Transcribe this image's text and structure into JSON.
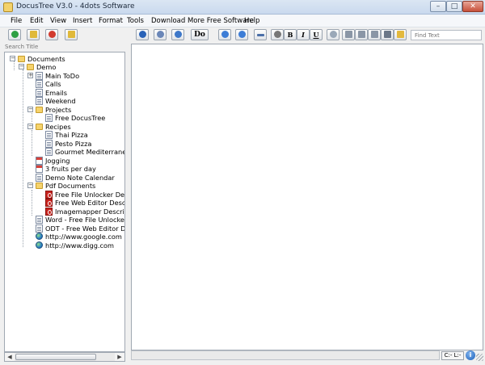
{
  "window": {
    "title": "DocusTree V3.0 - 4dots Software",
    "min": "–",
    "max": "□",
    "close": "✕"
  },
  "menu": [
    "File",
    "Edit",
    "View",
    "Insert",
    "Format",
    "Tools",
    "Download More Free Software",
    "Help"
  ],
  "toolbar": {
    "left": [
      {
        "name": "add-node-button",
        "icon": "green-plus-icon",
        "color": "#2ea043"
      },
      {
        "name": "add-folder-button",
        "icon": "folder-add-icon",
        "color": "#e0b93a"
      },
      {
        "name": "delete-node-button",
        "icon": "red-delete-icon",
        "color": "#d23b2f"
      },
      {
        "name": "open-folder-button",
        "icon": "folder-open-icon",
        "color": "#e0b93a"
      }
    ],
    "do_label": "Do",
    "bold": "B",
    "italic": "I",
    "underline": "U",
    "find_placeholder": "Find Text"
  },
  "search_placeholder": "Search Title",
  "tree": [
    {
      "label": "Documents",
      "icon": "folder-icon",
      "level": 0,
      "expander": "−"
    },
    {
      "label": "Demo",
      "icon": "folder-icon",
      "level": 1,
      "expander": "−"
    },
    {
      "label": "Main ToDo",
      "icon": "document-icon",
      "level": 2,
      "expander": "+"
    },
    {
      "label": "Calls",
      "icon": "document-icon",
      "level": 2
    },
    {
      "label": "Emails",
      "icon": "document-icon",
      "level": 2
    },
    {
      "label": "Weekend",
      "icon": "document-icon",
      "level": 2
    },
    {
      "label": "Projects",
      "icon": "folder-icon",
      "level": 2,
      "expander": "−"
    },
    {
      "label": "Free DocusTree",
      "icon": "document-icon",
      "level": 3
    },
    {
      "label": "Recipes",
      "icon": "folder-icon",
      "level": 2,
      "expander": "−"
    },
    {
      "label": "Thai Pizza",
      "icon": "document-icon",
      "level": 3
    },
    {
      "label": "Pesto Pizza",
      "icon": "document-icon",
      "level": 3
    },
    {
      "label": "Gourmet Mediterranean",
      "icon": "document-icon",
      "level": 3
    },
    {
      "label": "Jogging",
      "icon": "calendar-icon",
      "level": 2
    },
    {
      "label": "3 fruits per day",
      "icon": "calendar-icon",
      "level": 2
    },
    {
      "label": "Demo Note Calendar",
      "icon": "document-icon",
      "level": 2
    },
    {
      "label": "Pdf Documents",
      "icon": "folder-icon",
      "level": 2,
      "expander": "−"
    },
    {
      "label": "Free File Unlocker Desc",
      "icon": "pdf-icon",
      "level": 3
    },
    {
      "label": "Free Web Editor Descrip",
      "icon": "pdf-icon",
      "level": 3
    },
    {
      "label": "Imagemapper Descriptic",
      "icon": "pdf-icon",
      "level": 3
    },
    {
      "label": "Word - Free File Unlocker D",
      "icon": "document-icon",
      "level": 2
    },
    {
      "label": "ODT - Free Web Editor Des",
      "icon": "document-icon",
      "level": 2
    },
    {
      "label": "http://www.google.com",
      "icon": "web-icon",
      "level": 2
    },
    {
      "label": "http://www.digg.com",
      "icon": "web-icon",
      "level": 2
    }
  ],
  "status": {
    "position": "C:- L:-",
    "help": "i"
  }
}
